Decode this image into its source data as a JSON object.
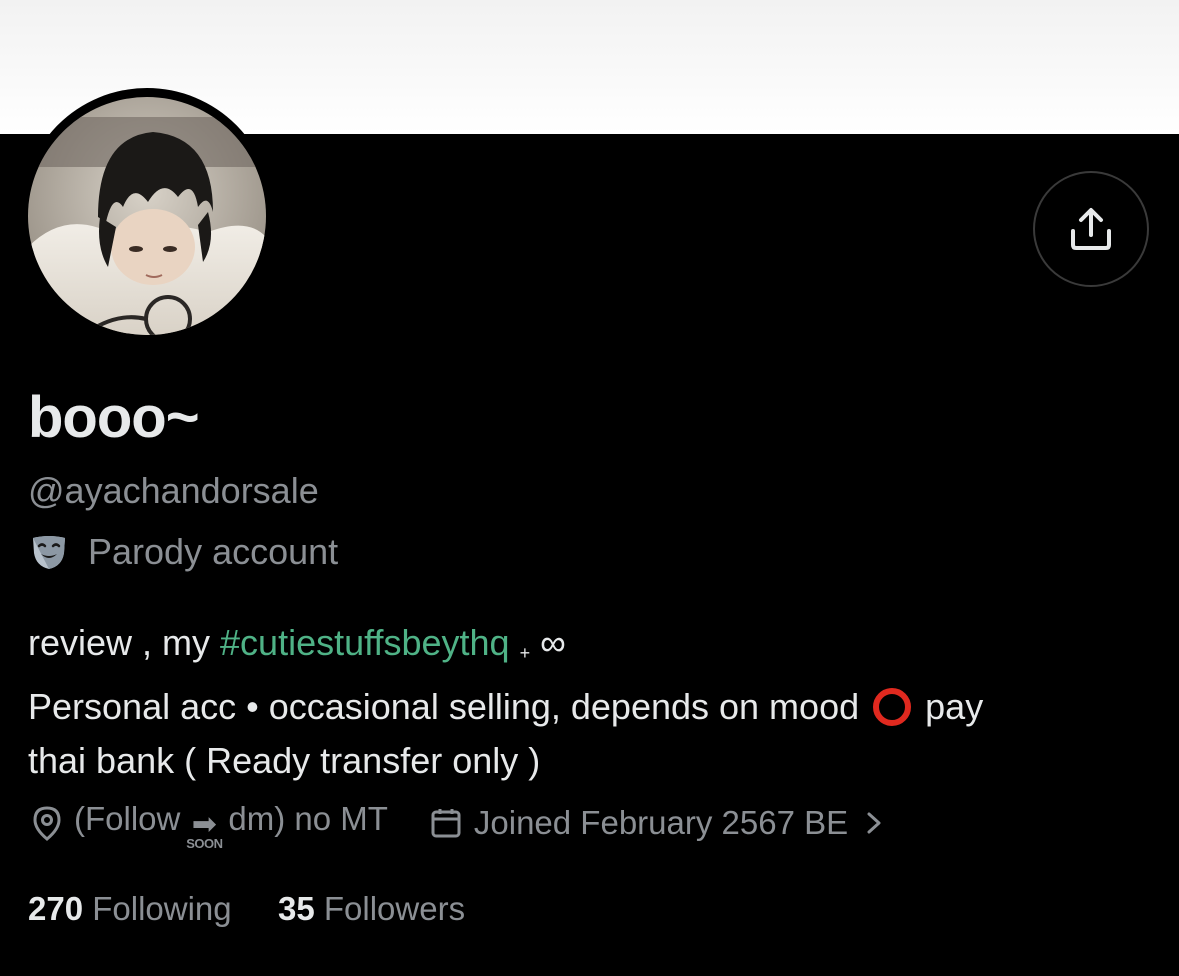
{
  "profile": {
    "display_name": "booo~",
    "handle": "@ayachandorsale",
    "parody_label": "Parody account",
    "bio": {
      "line1_prefix": "review , my ",
      "hashtag": "#cutiestuffsbeythq",
      "line1_plus": "+",
      "line1_infinity": "∞",
      "line2_a": "Personal acc • occasional selling, depends on mood",
      "line2_b": "pay",
      "line3": "thai bank ( Ready transfer only )"
    },
    "location_prefix": "(Follow",
    "location_soon": "SOON",
    "location_suffix": "dm) no MT",
    "joined": "Joined February 2567 BE",
    "following_count": "270",
    "following_label": "Following",
    "followers_count": "35",
    "followers_label": "Followers"
  },
  "icons": {
    "share": "share-upload-icon",
    "parody": "theater-mask-icon",
    "location": "location-pin-icon",
    "calendar": "calendar-icon",
    "chevron": "chevron-right-icon",
    "red_circle": "red-circle-icon"
  },
  "colors": {
    "background": "#000000",
    "text_primary": "#e7e9ea",
    "text_secondary": "#8b8f94",
    "hashtag": "#4fb286",
    "red_circle": "#e0291f"
  }
}
